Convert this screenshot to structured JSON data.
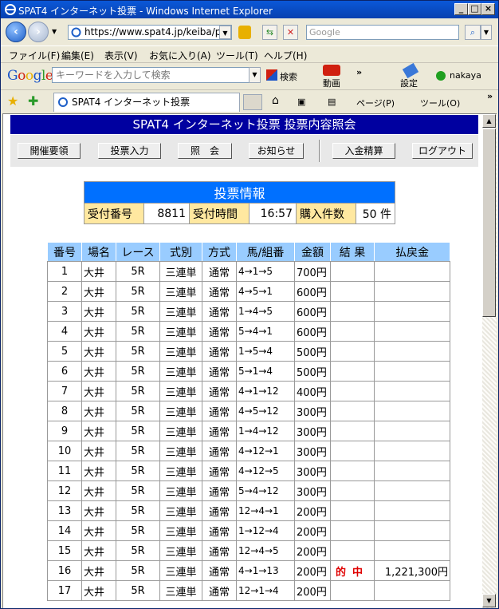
{
  "window": {
    "title": "SPAT4 インターネット投票 - Windows Internet Explorer",
    "address": "https://www.spat4.jp/keiba/pc",
    "search_placeholder": "Google"
  },
  "menu": [
    "ファイル(F)",
    "編集(E)",
    "表示(V)",
    "お気に入り(A)",
    "ツール(T)",
    "ヘルプ(H)"
  ],
  "google_toolbar": {
    "logo": "Google",
    "placeholder": "キーワードを入力して検索",
    "search_label": "検索",
    "video_label": "動画",
    "settings_label": "設定",
    "user": "nakaya"
  },
  "tabbar": {
    "tab_title": "SPAT4 インターネット投票",
    "page_label": "ページ(P)",
    "tools_label": "ツール(O)"
  },
  "page": {
    "header": "SPAT4 インターネット投票 投票内容照会",
    "buttons": [
      "開催要領",
      "投票入力",
      "照　会",
      "お知らせ",
      "入金精算",
      "ログアウト"
    ],
    "info": {
      "title": "投票情報",
      "receipt_label": "受付番号",
      "receipt_value": "8811",
      "time_label": "受付時間",
      "time_value": "16:57",
      "count_label": "購入件数",
      "count_value": "50 件"
    },
    "columns": [
      "番号",
      "場名",
      "レース",
      "式別",
      "方式",
      "馬/組番",
      "金額",
      "結 果",
      "払戻金"
    ],
    "rows": [
      [
        "1",
        "大井",
        "5R",
        "三連単",
        "通常",
        "4→1→5",
        "700円",
        "",
        ""
      ],
      [
        "2",
        "大井",
        "5R",
        "三連単",
        "通常",
        "4→5→1",
        "600円",
        "",
        ""
      ],
      [
        "3",
        "大井",
        "5R",
        "三連単",
        "通常",
        "1→4→5",
        "600円",
        "",
        ""
      ],
      [
        "4",
        "大井",
        "5R",
        "三連単",
        "通常",
        "5→4→1",
        "600円",
        "",
        ""
      ],
      [
        "5",
        "大井",
        "5R",
        "三連単",
        "通常",
        "1→5→4",
        "500円",
        "",
        ""
      ],
      [
        "6",
        "大井",
        "5R",
        "三連単",
        "通常",
        "5→1→4",
        "500円",
        "",
        ""
      ],
      [
        "7",
        "大井",
        "5R",
        "三連単",
        "通常",
        "4→1→12",
        "400円",
        "",
        ""
      ],
      [
        "8",
        "大井",
        "5R",
        "三連単",
        "通常",
        "4→5→12",
        "300円",
        "",
        ""
      ],
      [
        "9",
        "大井",
        "5R",
        "三連単",
        "通常",
        "1→4→12",
        "300円",
        "",
        ""
      ],
      [
        "10",
        "大井",
        "5R",
        "三連単",
        "通常",
        "4→12→1",
        "300円",
        "",
        ""
      ],
      [
        "11",
        "大井",
        "5R",
        "三連単",
        "通常",
        "4→12→5",
        "300円",
        "",
        ""
      ],
      [
        "12",
        "大井",
        "5R",
        "三連単",
        "通常",
        "5→4→12",
        "300円",
        "",
        ""
      ],
      [
        "13",
        "大井",
        "5R",
        "三連単",
        "通常",
        "12→4→1",
        "200円",
        "",
        ""
      ],
      [
        "14",
        "大井",
        "5R",
        "三連単",
        "通常",
        "1→12→4",
        "200円",
        "",
        ""
      ],
      [
        "15",
        "大井",
        "5R",
        "三連単",
        "通常",
        "12→4→5",
        "200円",
        "",
        ""
      ],
      [
        "16",
        "大井",
        "5R",
        "三連単",
        "通常",
        "4→1→13",
        "200円",
        "的中",
        "1,221,300円"
      ],
      [
        "17",
        "大井",
        "5R",
        "三連単",
        "通常",
        "12→1→4",
        "200円",
        "",
        ""
      ]
    ]
  },
  "colors": {
    "title_bar": "#0840b0",
    "page_header": "#0000a0",
    "info_header": "#0070ff",
    "info_label_bg": "#ffe8a0",
    "table_header_bg": "#99ccff",
    "hit_text": "#e00000"
  }
}
